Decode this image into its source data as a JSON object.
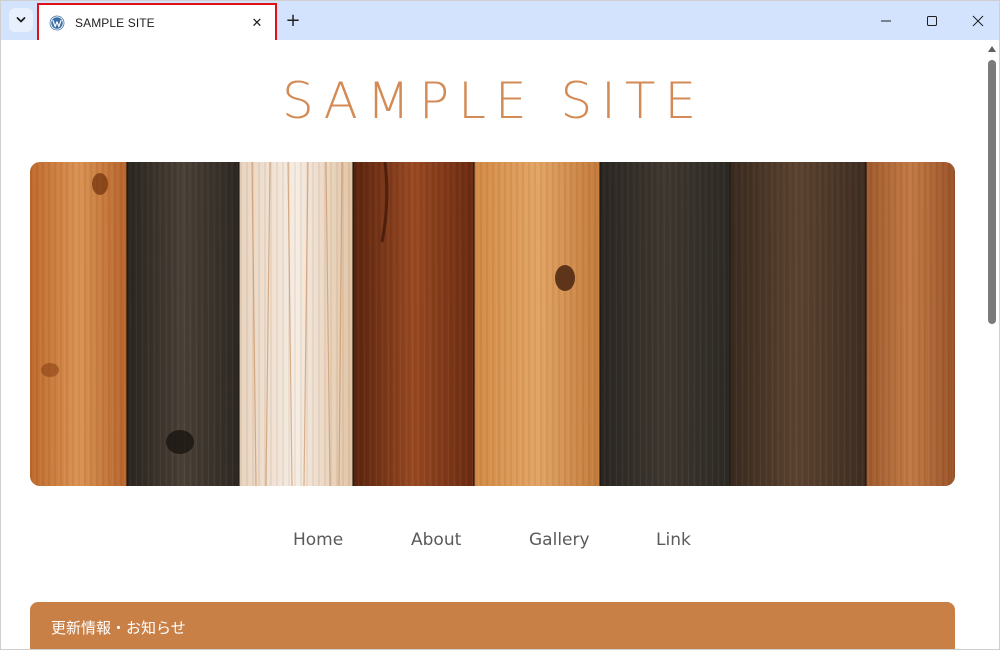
{
  "browser": {
    "tab": {
      "title": "SAMPLE SITE",
      "favicon": "wordpress-icon",
      "close_glyph": "✕"
    },
    "new_tab_glyph": "+",
    "tab_search_icon": "chevron-down-icon",
    "window_controls": [
      "minimize-icon",
      "maximize-icon",
      "close-icon"
    ],
    "accent_color": "#d3e3fd",
    "highlight_color": "#e0101a"
  },
  "site": {
    "title": "SAMPLE SITE",
    "title_color": "#d38a55",
    "hero_image": "wood-planks-image",
    "nav": [
      {
        "label": "Home"
      },
      {
        "label": "About"
      },
      {
        "label": "Gallery"
      },
      {
        "label": "Link"
      }
    ],
    "notice": {
      "heading": "更新情報・お知らせ",
      "color": "#c98047"
    }
  }
}
